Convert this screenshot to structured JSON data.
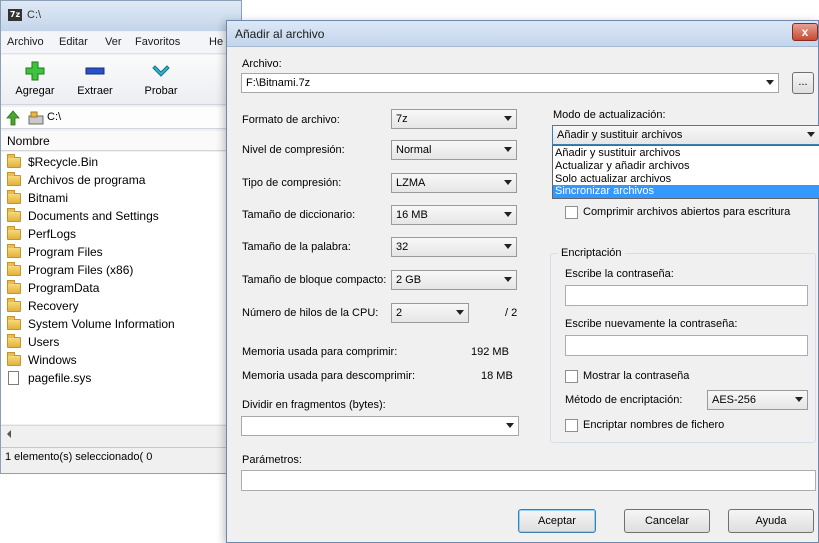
{
  "file_manager": {
    "title": "C:\\",
    "app_icon_text": "7z",
    "menu": [
      "Archivo",
      "Editar",
      "Ver",
      "Favoritos",
      "He"
    ],
    "toolbar": {
      "add_label": "Agregar",
      "extract_label": "Extraer",
      "test_label": "Probar"
    },
    "address": "C:\\",
    "column_header": "Nombre",
    "items": [
      {
        "label": "$Recycle.Bin",
        "type": "folder"
      },
      {
        "label": "Archivos de programa",
        "type": "folder"
      },
      {
        "label": "Bitnami",
        "type": "folder"
      },
      {
        "label": "Documents and Settings",
        "type": "folder"
      },
      {
        "label": "PerfLogs",
        "type": "folder"
      },
      {
        "label": "Program Files",
        "type": "folder"
      },
      {
        "label": "Program Files (x86)",
        "type": "folder"
      },
      {
        "label": "ProgramData",
        "type": "folder"
      },
      {
        "label": "Recovery",
        "type": "folder"
      },
      {
        "label": "System Volume Information",
        "type": "folder"
      },
      {
        "label": "Users",
        "type": "folder"
      },
      {
        "label": "Windows",
        "type": "folder"
      },
      {
        "label": "pagefile.sys",
        "type": "file"
      }
    ],
    "status": "1 elemento(s) seleccionado( 0"
  },
  "dialog": {
    "title": "Añadir al archivo",
    "close_label": "x",
    "archive_label": "Archivo:",
    "archive_value": "F:\\Bitnami.7z",
    "browse_label": "...",
    "format_label": "Formato de archivo:",
    "format_value": "7z",
    "level_label": "Nivel de compresión:",
    "level_value": "Normal",
    "method_label": "Tipo de compresión:",
    "method_value": "LZMA",
    "dict_label": "Tamaño de diccionario:",
    "dict_value": "16 MB",
    "word_label": "Tamaño de la palabra:",
    "word_value": "32",
    "solid_label": "Tamaño de bloque compacto:",
    "solid_value": "2 GB",
    "threads_label": "Número de hilos de la CPU:",
    "threads_value": "2",
    "threads_total": "/ 2",
    "mem_compress_label": "Memoria usada para comprimir:",
    "mem_compress_value": "192 MB",
    "mem_decompress_label": "Memoria usada para descomprimir:",
    "mem_decompress_value": "18 MB",
    "split_label": "Dividir en fragmentos (bytes):",
    "split_value": "",
    "params_label": "Parámetros:",
    "update_mode_label": "Modo de actualización:",
    "update_mode_value": "Añadir y sustituir archivos",
    "update_mode_options": [
      {
        "label": "Añadir y sustituir archivos",
        "selected": false
      },
      {
        "label": "Actualizar y añadir archivos",
        "selected": false
      },
      {
        "label": "Solo actualizar archivos",
        "selected": false
      },
      {
        "label": "Sincronizar archivos",
        "selected": true
      }
    ],
    "compress_shared_label": "Comprimir archivos abiertos para escritura",
    "encryption_group_label": "Encriptación",
    "password_label": "Escribe la contraseña:",
    "password_repeat_label": "Escribe nuevamente la contraseña:",
    "show_password_label": "Mostrar la contraseña",
    "enc_method_label": "Método de encriptación:",
    "enc_method_value": "AES-256",
    "encrypt_names_label": "Encriptar nombres de fichero",
    "ok_label": "Aceptar",
    "cancel_label": "Cancelar",
    "help_label": "Ayuda"
  }
}
